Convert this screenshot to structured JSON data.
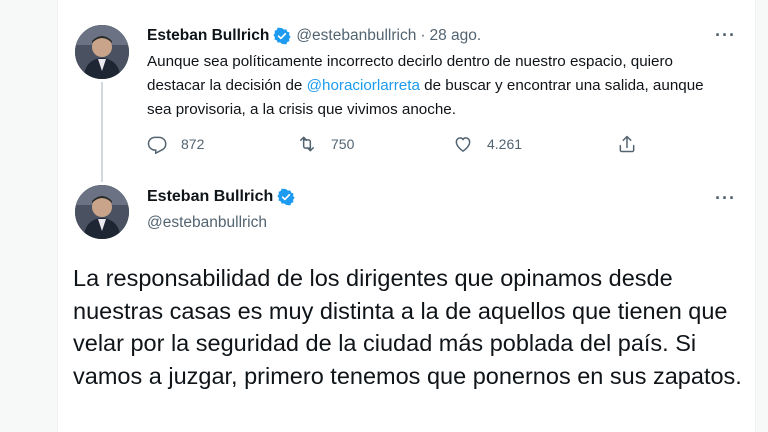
{
  "tweet1": {
    "display_name": "Esteban Bullrich",
    "handle": "@estebanbullrich",
    "separator": "·",
    "date": "28 ago.",
    "text_before": "Aunque sea políticamente incorrecto decirlo dentro de nuestro espacio, quiero destacar la decisión de ",
    "mention": "@horaciorlarreta",
    "text_after": " de buscar y encontrar una salida, aunque sea provisoria, a la crisis que vivimos anoche.",
    "replies": "872",
    "retweets": "750",
    "likes": "4.261"
  },
  "tweet2": {
    "display_name": "Esteban Bullrich",
    "handle": "@estebanbullrich",
    "text": "La responsabilidad de los dirigentes que opinamos desde nuestras casas es muy distinta a la de aquellos que tienen que velar por la seguridad de la ciudad más poblada del país. Si vamos a juzgar, primero tenemos que ponernos en sus zapatos."
  },
  "more_label": "···",
  "icons": [
    "verified-badge-icon",
    "reply-icon",
    "retweet-icon",
    "like-icon",
    "share-icon",
    "more-icon"
  ],
  "colors": {
    "accent": "#1d9bf0",
    "secondary_text": "#536471",
    "primary_text": "#0f1419"
  }
}
